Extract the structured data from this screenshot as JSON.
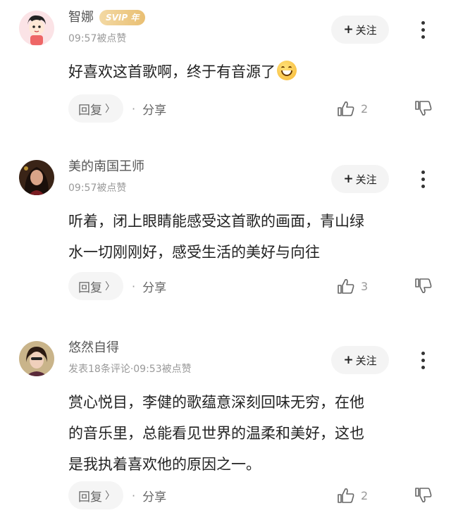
{
  "comments": [
    {
      "username": "智娜",
      "badge": "SVIP 年",
      "meta": "09:57被点赞",
      "follow_label": "关注",
      "content": "好喜欢这首歌啊，终于有音源了",
      "emoji": "grinning-face",
      "reply_label": "回复",
      "share_label": "分享",
      "likes": "2"
    },
    {
      "username": "美的南国王师",
      "meta": "09:57被点赞",
      "follow_label": "关注",
      "content_lines": [
        "听着，闭上眼睛能感受这首歌的画面，青山绿",
        "水一切刚刚好，感受生活的美好与向往"
      ],
      "reply_label": "回复",
      "share_label": "分享",
      "likes": "3"
    },
    {
      "username": "悠然自得",
      "meta": "发表18条评论·09:53被点赞",
      "follow_label": "关注",
      "content_lines": [
        "赏心悦目，李健的歌蕴意深刻回味无穷，在他",
        "的音乐里，总能看见世界的温柔和美好，这也",
        "是我执着喜欢他的原因之一。"
      ],
      "reply_label": "回复",
      "share_label": "分享",
      "likes": "2"
    }
  ],
  "colors": {
    "accent_svip": "#e9bf72",
    "text_primary": "#222222",
    "text_secondary": "#999999",
    "button_bg": "#f4f4f4"
  }
}
